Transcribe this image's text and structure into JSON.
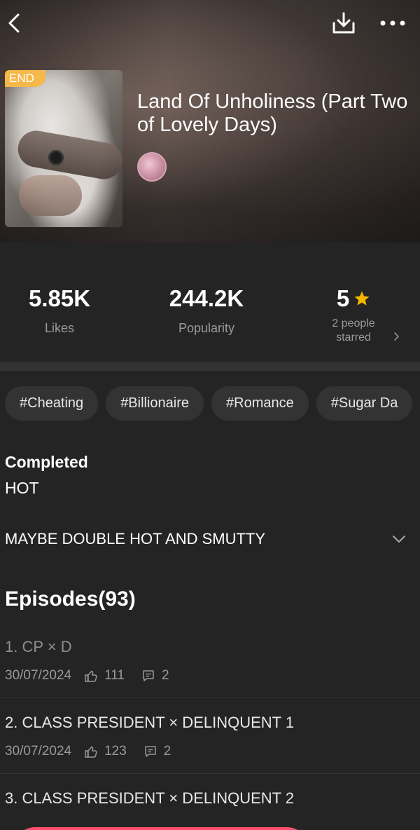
{
  "header": {
    "back_icon": "back-arrow-icon",
    "download_icon": "download-icon",
    "more_icon": "more-dots-icon"
  },
  "book": {
    "badge": "END",
    "title": "Land Of Unholiness (Part Two of Lovely Days)",
    "cover_icon": "cover-image"
  },
  "stats": {
    "likes_value": "5.85K",
    "likes_label": "Likes",
    "popularity_value": "244.2K",
    "popularity_label": "Popularity",
    "rating_value": "5",
    "rating_label_line1": "2 people",
    "rating_label_line2": "starred",
    "star_color": "#f5b400"
  },
  "tags": [
    "#Cheating",
    "#Billionaire",
    "#Romance",
    "#Sugar Da"
  ],
  "info": {
    "status": "Completed",
    "subtitle": "HOT",
    "description": "MAYBE DOUBLE HOT AND SMUTTY"
  },
  "episodes": {
    "heading": "Episodes(93)",
    "items": [
      {
        "title": "1. CP × D",
        "date": "30/07/2024",
        "likes": "111",
        "comments": "2"
      },
      {
        "title": "2. CLASS PRESIDENT × DELINQUENT 1",
        "date": "30/07/2024",
        "likes": "123",
        "comments": "2"
      },
      {
        "title": "3. CLASS PRESIDENT × DELINQUENT 2"
      }
    ]
  },
  "colors": {
    "background": "#242424",
    "accent": "#ff4f6e",
    "badge": "#f5b84a",
    "tag_bg": "#333333"
  }
}
